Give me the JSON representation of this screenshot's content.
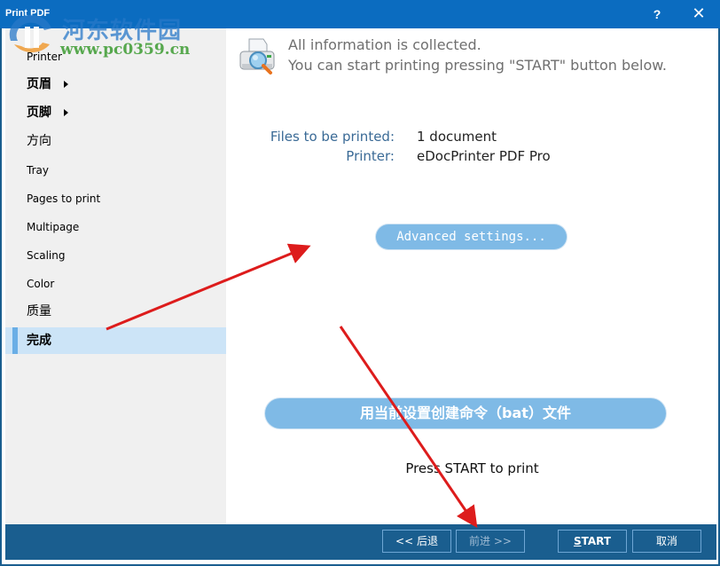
{
  "window": {
    "title": "Print PDF",
    "help_label": "?",
    "close_label": "✕"
  },
  "sidebar": {
    "items": [
      {
        "label": "Printer",
        "has_arrow": false,
        "bold": false
      },
      {
        "label": "页眉",
        "has_arrow": true,
        "bold": true
      },
      {
        "label": "页脚",
        "has_arrow": true,
        "bold": true
      },
      {
        "label": "方向",
        "has_arrow": false,
        "bold": false
      },
      {
        "label": "Tray",
        "has_arrow": false,
        "bold": false
      },
      {
        "label": "Pages to print",
        "has_arrow": false,
        "bold": false
      },
      {
        "label": "Multipage",
        "has_arrow": false,
        "bold": false
      },
      {
        "label": "Scaling",
        "has_arrow": false,
        "bold": false
      },
      {
        "label": "Color",
        "has_arrow": false,
        "bold": false
      },
      {
        "label": "质量",
        "has_arrow": false,
        "bold": false
      },
      {
        "label": "完成",
        "has_arrow": false,
        "bold": true,
        "active": true
      }
    ]
  },
  "main": {
    "icon": "printer-magnifier-icon",
    "heading_line1": "All information is collected.",
    "heading_line2": "You can start printing pressing \"START\" button below.",
    "files_label": "Files to be printed:",
    "files_value": "1 document",
    "printer_label": "Printer:",
    "printer_value": "eDocPrinter PDF Pro",
    "advanced_button": "Advanced settings...",
    "bat_button": "用当前设置创建命令（bat）文件",
    "press_text": "Press START to print"
  },
  "footer": {
    "back_label": "<< 后退",
    "next_label": "前进 >>",
    "start_label_underlined": "S",
    "start_label_rest": "TART",
    "cancel_label": "取消"
  },
  "watermark": {
    "site_name": "河东软件园",
    "url": "www.pc0359.cn"
  },
  "colors": {
    "titlebar": "#0b6cc0",
    "footer": "#1a5e8f",
    "sidebar_bg": "#f0f0f0",
    "active_item_bg": "#cce4f7",
    "active_marker": "#6aaee6",
    "pill_button": "#7fbae6",
    "info_label": "#3a6a96",
    "annotation_arrow": "#dd1c1c"
  }
}
